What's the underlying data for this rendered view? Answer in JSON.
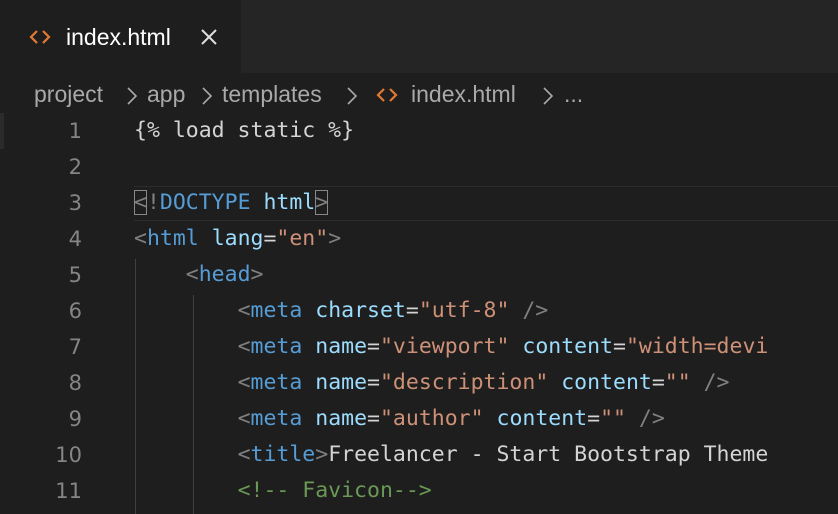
{
  "tab": {
    "icon": "html-brackets-icon",
    "label": "index.html",
    "close_icon": "close-icon"
  },
  "breadcrumb": {
    "items": [
      "project",
      "app",
      "templates",
      "index.html",
      "..."
    ],
    "separator_icon": "chevron-right-icon",
    "file_icon": "html-brackets-icon"
  },
  "editor": {
    "line_numbers": [
      "1",
      "2",
      "3",
      "4",
      "5",
      "6",
      "7",
      "8",
      "9",
      "10",
      "11"
    ],
    "lines": {
      "l1": {
        "text": "{% load static %}"
      },
      "l3": {
        "lt": "<",
        "bang": "!",
        "doctype": "DOCTYPE",
        "html": "html",
        "gt": ">"
      },
      "l4": {
        "lt": "<",
        "tag": "html",
        "attr": "lang",
        "eq": "=",
        "val": "\"en\"",
        "gt": ">"
      },
      "l5": {
        "lt": "<",
        "tag": "head",
        "gt": ">"
      },
      "l6": {
        "lt": "<",
        "tag": "meta",
        "attr": "charset",
        "eq": "=",
        "val": "\"utf-8\"",
        "end": " />"
      },
      "l7": {
        "lt": "<",
        "tag": "meta",
        "attr1": "name",
        "eq1": "=",
        "val1": "\"viewport\"",
        "attr2": "content",
        "eq2": "=",
        "val2": "\"width=devi"
      },
      "l8": {
        "lt": "<",
        "tag": "meta",
        "attr1": "name",
        "eq1": "=",
        "val1": "\"description\"",
        "attr2": "content",
        "eq2": "=",
        "val2": "\"\"",
        "end": " />"
      },
      "l9": {
        "lt": "<",
        "tag": "meta",
        "attr1": "name",
        "eq1": "=",
        "val1": "\"author\"",
        "attr2": "content",
        "eq2": "=",
        "val2": "\"\"",
        "end": " />"
      },
      "l10": {
        "lt": "<",
        "tag": "title",
        "gt": ">",
        "text": "Freelancer - Start Bootstrap Theme"
      },
      "l11": {
        "comment": "<!-- Favicon-->"
      }
    }
  },
  "colors": {
    "background": "#1e1e1e",
    "tab_bar": "#252526",
    "tag": "#569cd6",
    "attribute": "#9cdcfe",
    "string": "#ce9178",
    "comment": "#6a9955",
    "icon_orange": "#e37933"
  }
}
